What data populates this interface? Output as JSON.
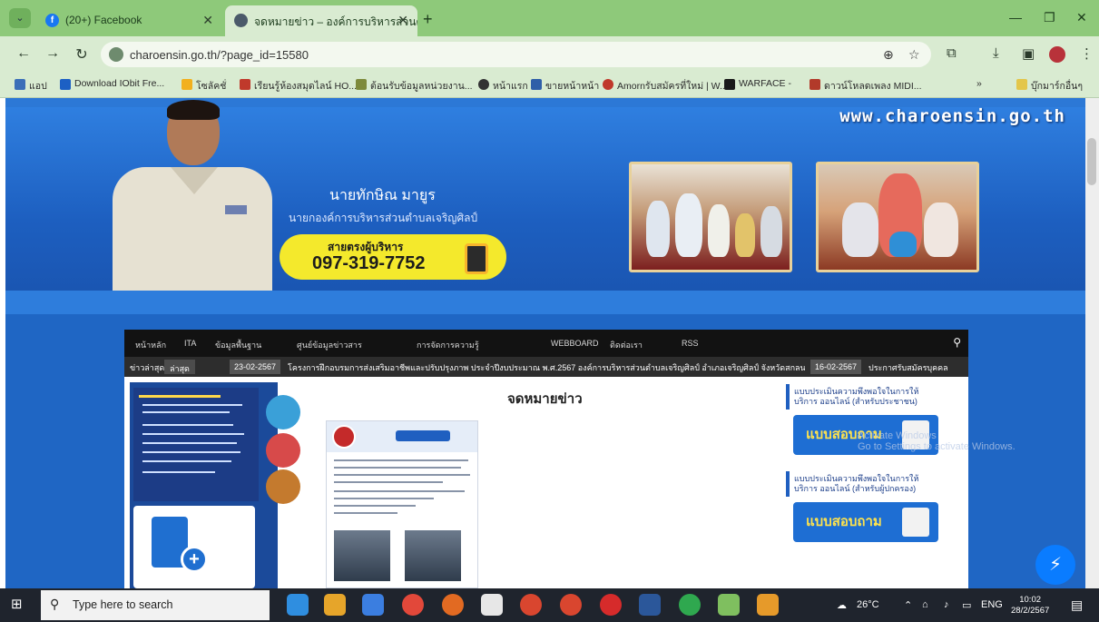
{
  "browser": {
    "tabs": [
      {
        "title": "(20+) Facebook",
        "active": false
      },
      {
        "title": "จดหมายข่าว – องค์การบริหารส่วนต…",
        "active": true
      }
    ],
    "url": "charoensin.go.th/?page_id=15580",
    "bookmarks": [
      "แอป",
      "Download IObit Fre...",
      "โซลัคชั่",
      "เรียนรู้ห้องสมุดไลน์ HO...",
      "ต้อนรับข้อมูลหน่วยงาน...",
      "หน้าแรก",
      "ขายหน้าหน้า",
      "Amornรับสมัครที่ใหม่ | W...",
      "WARFACE -",
      "ดาวน์โหลดเพลง MIDI...",
      "บุ๊กมาร์กอื่นๆ"
    ]
  },
  "page": {
    "site_url": "www.charoensin.go.th",
    "executive_name": "นายทักษิณ มายูร",
    "executive_title": "นายกองค์การบริหารส่วนตำบลเจริญศิลป์",
    "hotline_label": "สายตรงผู้บริหาร",
    "hotline_number": "097-319-7752",
    "nav": [
      "หน้าหลัก",
      "ITA",
      "ข้อมูลพื้นฐาน",
      "ศูนย์ข้อมูลข่าวสาร",
      "การจัดการความรู้",
      "WEBBOARD",
      "ติดต่อเรา",
      "RSS"
    ],
    "ticker": {
      "label": "ข่าวล่าสุด",
      "tag": "ล่าสุด",
      "date_1": "23-02-2567",
      "text_1": "โครงการฝึกอบรมการส่งเสริมอาชีพและปรับปรุงภาพ ประจำปีงบประมาณ พ.ศ.2567 องค์การบริหารส่วนตำบลเจริญศิลป์ อำเภอเจริญศิลป์ จังหวัดสกลนคร",
      "date_2": "16-02-2567",
      "text_2": "ประกาศรับสมัครบุคคล"
    },
    "article_title": "จดหมายข่าว",
    "right_sidebar": [
      {
        "title": "แบบประเมินความพึงพอใจในการให้บริการ ออนไลน์ (สำหรับประชาชน)",
        "button": "แบบสอบถาม"
      },
      {
        "title": "แบบประเมินความพึงพอใจในการให้บริการ ออนไลน์ (สำหรับผู้ปกครอง)",
        "button": "แบบสอบถาม"
      }
    ],
    "activate_text": "Activate Windows\nGo to Settings to activate Windows."
  },
  "taskbar": {
    "search_placeholder": "Type here to search",
    "weather": "26°C",
    "language": "ENG",
    "time": "10:02",
    "date": "28/2/2567"
  }
}
